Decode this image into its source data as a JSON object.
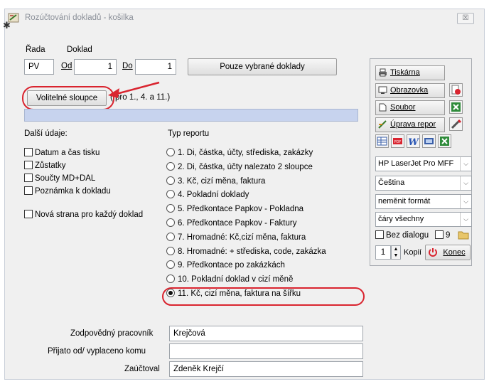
{
  "window": {
    "title": "Rozúčtování dokladů - košilka",
    "close": "☒"
  },
  "icons": {
    "settings": "gear-icon"
  },
  "rada": {
    "label": "Řada",
    "value": "PV"
  },
  "doklad": {
    "label": "Doklad",
    "od_label": "Od",
    "od_value": "1",
    "do_label": "Do",
    "do_value": "1"
  },
  "pouze_button": "Pouze vybrané doklady",
  "volitelne": {
    "button": "Volitelné sloupce",
    "note": "( pro 1., 4. a 11.)"
  },
  "dalsi": {
    "title": "Další údaje:",
    "items": [
      "Datum a čas tisku",
      "Zůstatky",
      "Součty MD+DAL",
      "Poznámka k dokladu"
    ],
    "nova_strana": "Nová strana pro každý doklad"
  },
  "typ": {
    "title": "Typ reportu",
    "options": [
      "1. Di, částka, účty, střediska, zakázky",
      "2. Di, částka, účty nalezato 2 sloupce",
      "3. Kč, cizí měna, faktura",
      "4. Pokladní doklady",
      "5. Předkontace Papkov - Pokladna",
      "6. Předkontace Papkov - Faktury",
      "7. Hromadné: Kč,cizí měna, faktura",
      "8. Hromadné: + střediska, code, zakázka",
      "9. Předkontace po zakázkách",
      "10. Pokladní doklad v cizí měně",
      "11. Kč, cizí měna, faktura na šířku"
    ],
    "selected": 10
  },
  "right": {
    "tiskarna": "Tiskárna",
    "obrazovka": "Obrazovka",
    "soubor": "Soubor",
    "uprava": "Úprava repor",
    "printer": "HP LaserJet Pro MFF",
    "language": "Čeština",
    "format": "neměnit formát",
    "lines": "čáry všechny",
    "bez_dialogu": "Bez dialogu",
    "nine": "9",
    "copies_value": "1",
    "kopii": "Kopií",
    "konec": "Konec"
  },
  "bottom": {
    "zodpovedny_label": "Zodpovědný pracovník",
    "zodpovedny_value": "Krejčová",
    "prijato_label": "Přijato od/ vyplaceno komu",
    "prijato_value": "",
    "zauctoval_label": "Zaúčtoval",
    "zauctoval_value": "Zdeněk Krejčí"
  },
  "colors": {
    "highlight": "#d9242f",
    "info_bar": "#c7d3ee"
  }
}
